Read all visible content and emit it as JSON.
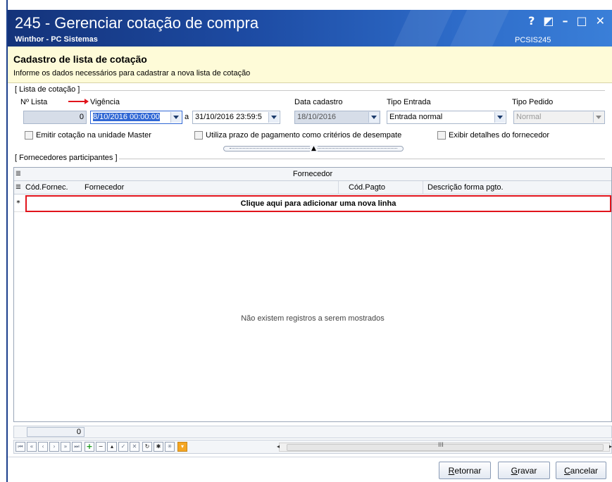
{
  "window": {
    "title": "245 - Gerenciar cotação de compra",
    "company": "Winthor - PC Sistemas",
    "code": "PCSIS245",
    "controls": [
      "?",
      "◩",
      "–",
      "□",
      "✕"
    ]
  },
  "header": {
    "title": "Cadastro de lista de cotação",
    "subtitle": "Informe os dados necessários para cadastrar a nova lista de cotação"
  },
  "lista": {
    "group_label": "[ Lista de cotação ]",
    "num_label": "Nº Lista",
    "num_value": "0",
    "vigencia_label": "Vigência",
    "vigencia_start": "8/10/2016 00:00:00",
    "vigencia_sep": "a",
    "vigencia_end": "31/10/2016 23:59:5",
    "data_cadastro_label": "Data cadastro",
    "data_cadastro_value": "18/10/2016",
    "tipo_entrada_label": "Tipo Entrada",
    "tipo_entrada_value": "Entrada normal",
    "tipo_pedido_label": "Tipo Pedido",
    "tipo_pedido_value": "Normal",
    "chk_master": "Emitir cotação na unidade Master",
    "chk_prazo": "Utiliza prazo de pagamento como critérios de desempate",
    "chk_detalhes": "Exibir detalhes do fornecedor"
  },
  "fornecedores": {
    "group_label": "[ Fornecedores participantes ]",
    "band_label": "Fornecedor",
    "columns": [
      "Cód.Fornec.",
      "Fornecedor",
      "Cód.Pagto",
      "Descrição forma pgto."
    ],
    "new_row_indicator": "*",
    "new_row_text": "Clique aqui para adicionar uma nova linha",
    "empty_text": "Não existem registros a serem mostrados",
    "footer_count": "0"
  },
  "nav": {
    "icons": [
      "first-icon",
      "prev-page-icon",
      "prev-icon",
      "next-icon",
      "next-page-icon",
      "last-icon",
      "add-icon",
      "delete-icon",
      "edit-icon",
      "confirm-icon",
      "cancel-edit-icon",
      "refresh-icon",
      "asterisk-icon",
      "asterisk-light-icon",
      "filter-icon"
    ]
  },
  "buttons": {
    "retornar_u": "R",
    "retornar_rest": "etornar",
    "gravar_u": "G",
    "gravar_rest": "ravar",
    "cancelar_u": "C",
    "cancelar_rest": "ancelar"
  },
  "colors": {
    "titlebar": "#1d4ba3",
    "header_band": "#fefbd8",
    "highlight": "#e1141c",
    "selection": "#3168d5"
  }
}
